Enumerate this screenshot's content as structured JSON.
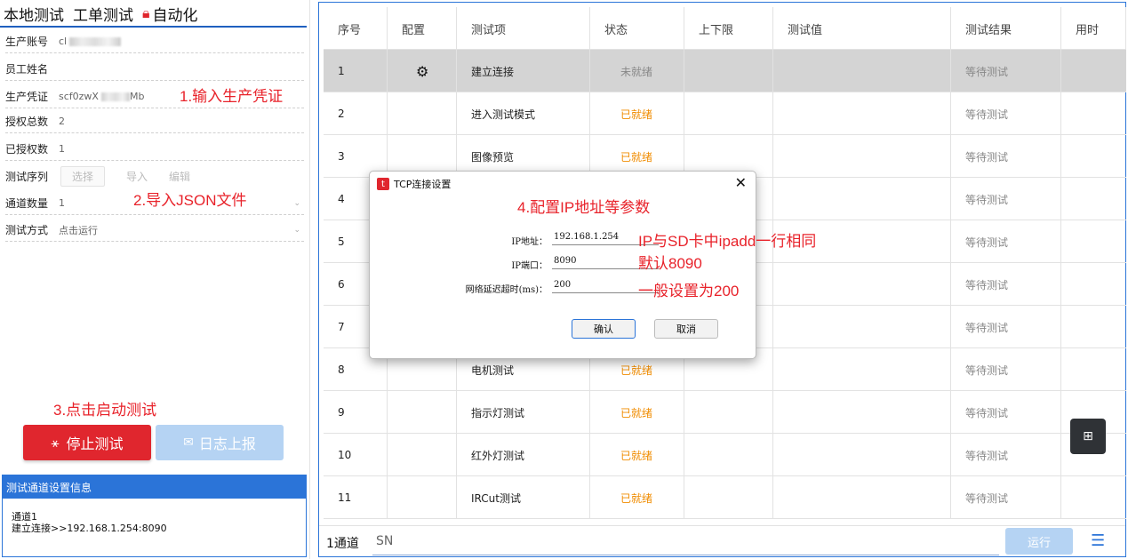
{
  "left": {
    "tabs": [
      "本地测试",
      "工单测试",
      "自动化"
    ],
    "fields": {
      "account": {
        "label": "生产账号",
        "value": "cl"
      },
      "name": {
        "label": "员工姓名",
        "value": ""
      },
      "credential": {
        "label": "生产凭证",
        "value_prefix": "scf0zwX",
        "value_suffix": "Mb"
      },
      "auth_total": {
        "label": "授权总数",
        "value": "2"
      },
      "authorized": {
        "label": "已授权数",
        "value": "1"
      },
      "sequence": {
        "label": "测试序列",
        "select": "选择",
        "import": "导入",
        "edit": "编辑"
      },
      "channels": {
        "label": "通道数量",
        "value": "1"
      },
      "mode": {
        "label": "测试方式",
        "value": "点击运行"
      }
    },
    "annotations": {
      "a1": "1.输入生产凭证",
      "a2": "2.导入JSON文件",
      "a3": "3.点击启动测试"
    },
    "stop_label": "停止测试",
    "log_label": "日志上报",
    "info": {
      "title": "测试通道设置信息",
      "line1": "通道1",
      "line2": "建立连接>>192.168.1.254:8090"
    }
  },
  "table": {
    "headers": [
      "序号",
      "配置",
      "测试项",
      "状态",
      "上下限",
      "测试值",
      "测试结果",
      "用时"
    ],
    "rows": [
      {
        "no": "1",
        "item": "建立连接",
        "status": "未就绪",
        "result": "等待测试"
      },
      {
        "no": "2",
        "item": "进入测试模式",
        "status": "已就绪",
        "result": "等待测试"
      },
      {
        "no": "3",
        "item": "图像预览",
        "status": "已就绪",
        "result": "等待测试"
      },
      {
        "no": "4",
        "item": "",
        "status": "",
        "result": "等待测试"
      },
      {
        "no": "5",
        "item": "",
        "status": "",
        "result": "等待测试"
      },
      {
        "no": "6",
        "item": "",
        "status": "",
        "result": "等待测试"
      },
      {
        "no": "7",
        "item": "",
        "status": "",
        "result": "等待测试"
      },
      {
        "no": "8",
        "item": "电机测试",
        "status": "已就绪",
        "result": "等待测试"
      },
      {
        "no": "9",
        "item": "指示灯测试",
        "status": "已就绪",
        "result": "等待测试"
      },
      {
        "no": "10",
        "item": "红外灯测试",
        "status": "已就绪",
        "result": "等待测试"
      },
      {
        "no": "11",
        "item": "IRCut测试",
        "status": "已就绪",
        "result": "等待测试"
      }
    ],
    "bottom": {
      "channel": "1通道",
      "sn": "SN",
      "run": "运行"
    }
  },
  "dialog": {
    "title": "TCP连接设置",
    "annotation": "4.配置IP地址等参数",
    "ip_label": "IP地址：",
    "ip_value": "192.168.1.254",
    "ip_note": "IP与SD卡中ipadd一行相同",
    "port_label": "IP端口：",
    "port_value": "8090",
    "port_note": "默认8090",
    "timeout_label": "网络延迟超时(ms)：",
    "timeout_value": "200",
    "timeout_note": "一般设置为200",
    "ok": "确认",
    "cancel": "取消"
  },
  "colors": {
    "accent_blue": "#2b74d8",
    "stop_red": "#e0262e",
    "ready_orange": "#f08c00",
    "annotation_red": "#e8222a"
  }
}
